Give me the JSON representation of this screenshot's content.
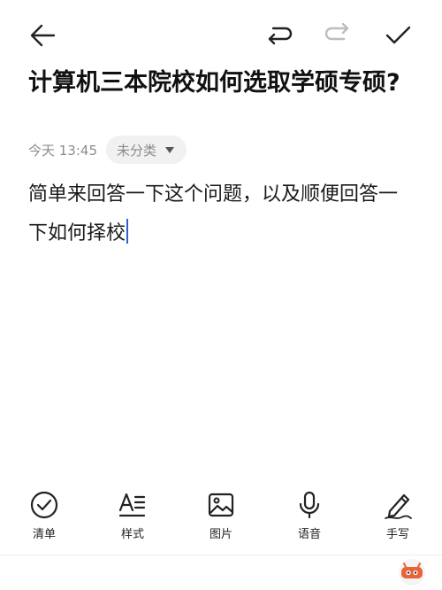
{
  "note": {
    "title": "计算机三本院校如何选取学硕专硕?",
    "time": "今天 13:45",
    "category": "未分类",
    "body_line1": "简单来回答一下这个问题，以及顺便回答一",
    "body_line2": "下如何择校"
  },
  "toolbar": {
    "items": [
      {
        "label": "清单",
        "icon": "checklist-icon"
      },
      {
        "label": "样式",
        "icon": "text-style-icon"
      },
      {
        "label": "图片",
        "icon": "image-icon"
      },
      {
        "label": "语音",
        "icon": "microphone-icon"
      },
      {
        "label": "手写",
        "icon": "handwriting-pen-icon"
      }
    ]
  },
  "colors": {
    "accent_cursor": "#2f5fd0",
    "muted_text": "#8c8c8c",
    "category_bg": "#f1f1f1"
  }
}
